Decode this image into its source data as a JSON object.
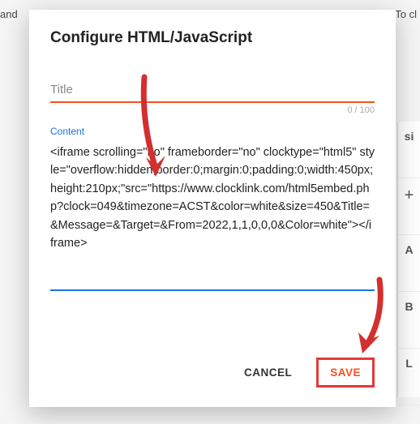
{
  "background": {
    "left_text": "and",
    "right_text": "To cl",
    "panel": {
      "header": "si",
      "plus": "+",
      "rows": [
        "A",
        "B",
        "L"
      ]
    }
  },
  "modal": {
    "title": "Configure HTML/JavaScript",
    "title_field": {
      "placeholder": "Title",
      "value": "",
      "counter": "0 / 100"
    },
    "content_field": {
      "label": "Content",
      "value": "<iframe scrolling=\"no\" frameborder=\"no\" clocktype=\"html5\" style=\"overflow:hidden;border:0;margin:0;padding:0;width:450px;height:210px;\"src=\"https://www.clocklink.com/html5embed.php?clock=049&timezone=ACST&color=white&size=450&Title=&Message=&Target=&From=2022,1,1,0,0,0&Color=white\"></iframe>"
    },
    "actions": {
      "cancel": "CANCEL",
      "save": "SAVE"
    }
  }
}
